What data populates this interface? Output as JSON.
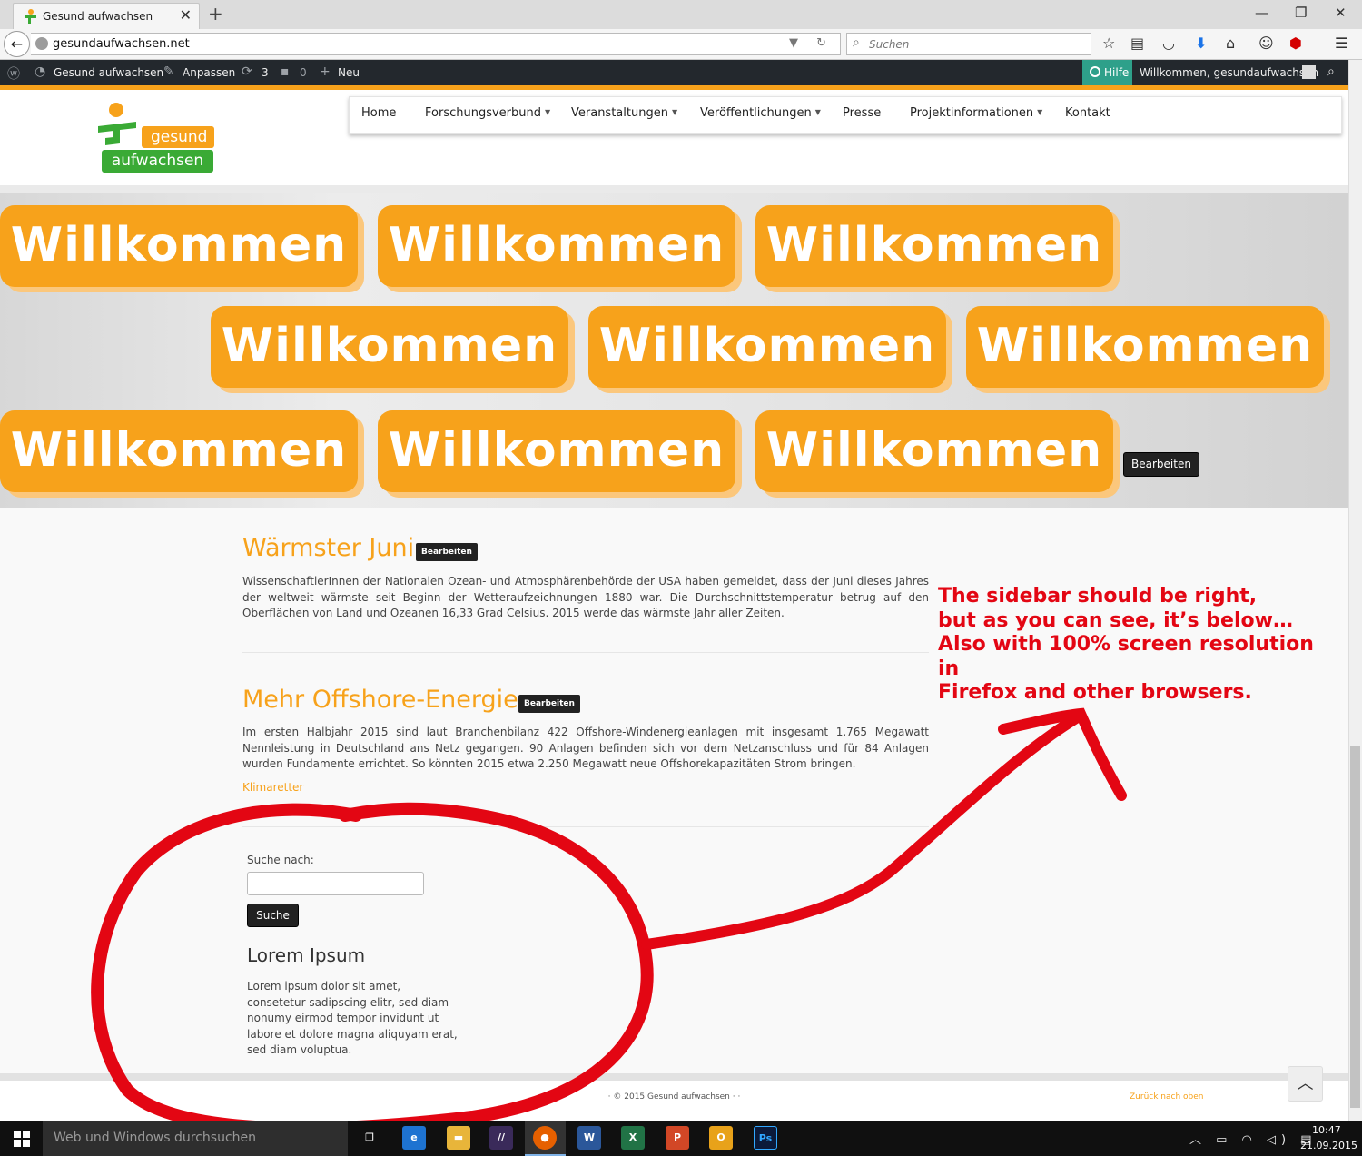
{
  "browser": {
    "tab_title": "Gesund aufwachsen",
    "tab_close": "✕",
    "new_tab": "+",
    "window_controls": [
      "—",
      "❐",
      "✕"
    ],
    "url": "gesundaufwachsen.net",
    "url_actions": "▼ ↻",
    "search_placeholder": "Suchen",
    "toolbar_icons": [
      "star-icon",
      "reading-list-icon",
      "pocket-icon",
      "download-icon",
      "home-icon",
      "chat-icon",
      "adblock-icon",
      "menu-icon"
    ]
  },
  "adminbar": {
    "site_name": "Gesund aufwachsen",
    "customize": "Anpassen",
    "updates_count": "3",
    "comments_count": "0",
    "new_label": "Neu",
    "help": "Hilfe",
    "welcome": "Willkommen, gesundaufwachsen"
  },
  "logo": {
    "line1": "gesund",
    "line2": "aufwachsen"
  },
  "menu": {
    "items": [
      {
        "label": "Home",
        "dropdown": false
      },
      {
        "label": "Forschungsverbund",
        "dropdown": true
      },
      {
        "label": "Veranstaltungen",
        "dropdown": true
      },
      {
        "label": "Veröffentlichungen",
        "dropdown": true
      },
      {
        "label": "Presse",
        "dropdown": false
      },
      {
        "label": "Projektinformationen",
        "dropdown": true
      },
      {
        "label": "Kontakt",
        "dropdown": false
      }
    ]
  },
  "banner": {
    "word": "Willkommen",
    "edit_label": "Bearbeiten"
  },
  "posts": [
    {
      "title": "Wärmster Juni",
      "edit_label": "Bearbeiten",
      "text": "WissenschaftlerInnen der Nationalen Ozean- und Atmosphärenbehörde der USA haben gemeldet, dass der Juni dieses Jahres der weltweit wärmste seit Beginn der Wetteraufzeichnungen 1880 war. Die Durchschnittstemperatur betrug auf den Oberflächen von Land und Ozeanen 16,33 Grad Celsius. 2015 werde das wärmste Jahr aller Zeiten."
    },
    {
      "title": "Mehr Offshore-Energie",
      "edit_label": "Bearbeiten",
      "text": "Im ersten Halbjahr 2015 sind laut Branchenbilanz 422 Offshore-Windenergieanlagen mit insgesamt 1.765 Megawatt Nennleistung in Deutschland ans Netz gegangen. 90 Anlagen befinden sich vor dem Netzanschluss und für 84 Anlagen wurden Fundamente errichtet. So könnten 2015 etwa 2.250 Megawatt neue Offshorekapazitäten Strom bringen.",
      "source": "Klimaretter"
    }
  ],
  "sidebar": {
    "search_label": "Suche nach:",
    "search_button": "Suche",
    "widget_title": "Lorem Ipsum",
    "widget_text": "Lorem ipsum dolor sit amet, consetetur sadipscing elitr, sed diam nonumy eirmod tempor invidunt ut labore et dolore magna aliquyam erat, sed diam voluptua."
  },
  "annotation": {
    "lines": [
      "The sidebar should be right,",
      "but as you can see, it’s below…",
      "Also with 100% screen resolution in",
      "Firefox and other browsers."
    ],
    "color": "#e30613"
  },
  "footer": {
    "copyright": "· © 2015 Gesund aufwachsen · ·",
    "back_to_top": "Zurück nach oben",
    "to_top_icon": "︿"
  },
  "taskbar": {
    "search_placeholder": "Web und Windows durchsuchen",
    "apps": [
      {
        "name": "task-view-icon",
        "label": "❐",
        "color": "#101010"
      },
      {
        "name": "edge-icon",
        "label": "e",
        "color": "#1e73d1"
      },
      {
        "name": "explorer-icon",
        "label": "▬",
        "color": "#e8b53a"
      },
      {
        "name": "app-icon",
        "label": "//",
        "color": "#3a2a5a"
      },
      {
        "name": "firefox-icon",
        "label": "●",
        "color": "#e66000"
      },
      {
        "name": "word-icon",
        "label": "W",
        "color": "#2b579a"
      },
      {
        "name": "excel-icon",
        "label": "X",
        "color": "#217346"
      },
      {
        "name": "powerpoint-icon",
        "label": "P",
        "color": "#d24726"
      },
      {
        "name": "outlook-icon",
        "label": "O",
        "color": "#e8a21a"
      },
      {
        "name": "photoshop-icon",
        "label": "Ps",
        "color": "#0b1a3a"
      }
    ],
    "tray": "︿ ▭ ◠ ◁) ▤",
    "time": "10:47",
    "date": "21.09.2015"
  },
  "colors": {
    "brand_orange": "#f7a21b",
    "brand_green": "#3aaa35",
    "admin_bar": "#23282d",
    "help_teal": "#2ea08a"
  }
}
